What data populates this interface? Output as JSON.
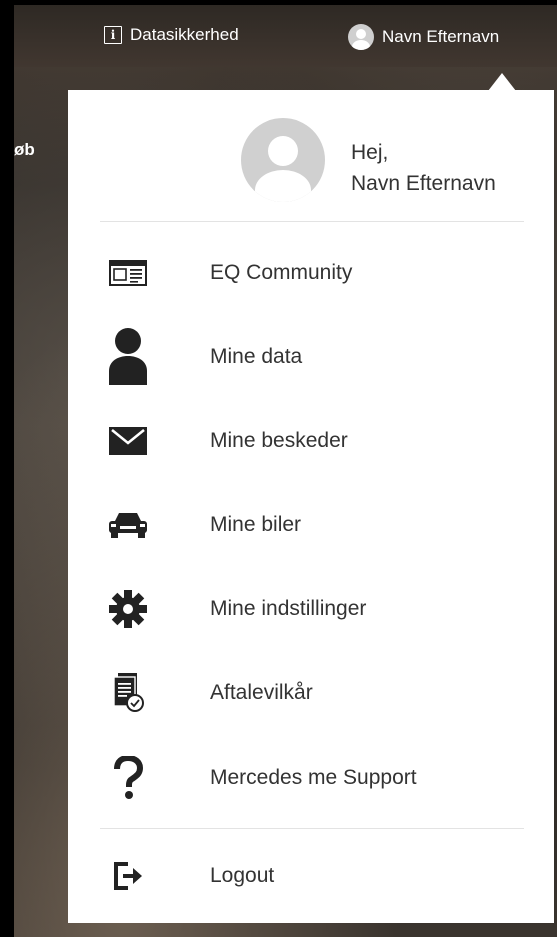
{
  "header": {
    "security_label": "Datasikkerhed",
    "user_name": "Navn Efternavn",
    "side_fragment": "øb"
  },
  "dropdown": {
    "greeting_line1": "Hej,",
    "greeting_line2": "Navn Efternavn",
    "items": [
      {
        "label": "EQ Community",
        "icon": "community-icon"
      },
      {
        "label": "Mine data",
        "icon": "person-icon"
      },
      {
        "label": "Mine beskeder",
        "icon": "mail-icon"
      },
      {
        "label": "Mine biler",
        "icon": "car-icon"
      },
      {
        "label": "Mine indstillinger",
        "icon": "gear-icon"
      },
      {
        "label": "Aftalevilkår",
        "icon": "document-icon"
      },
      {
        "label": "Mercedes me Support",
        "icon": "question-icon"
      }
    ],
    "logout_label": "Logout"
  }
}
